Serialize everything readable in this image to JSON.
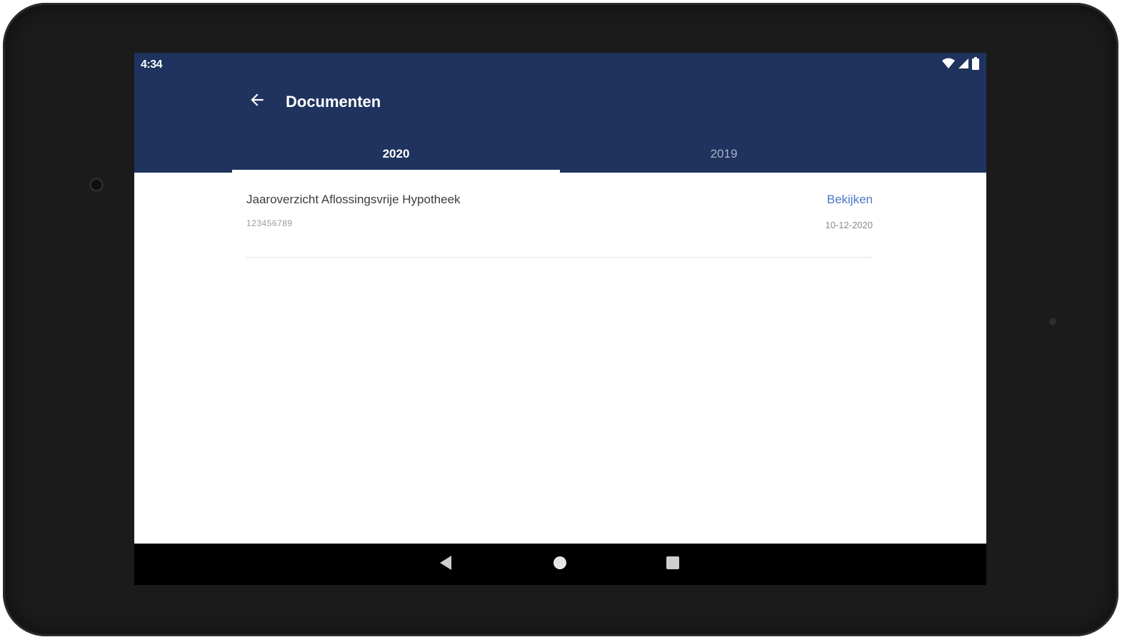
{
  "status_bar": {
    "time": "4:34",
    "icons": [
      "wifi-icon",
      "cell-signal-icon",
      "battery-icon"
    ]
  },
  "toolbar": {
    "back_icon": "arrow-back-icon",
    "title": "Documenten"
  },
  "tabs": [
    {
      "label": "2020",
      "selected": true
    },
    {
      "label": "2019",
      "selected": false
    }
  ],
  "documents": [
    {
      "title": "Jaaroverzicht Aflossingsvrije Hypotheek",
      "number": "123456789",
      "action_label": "Bekijken",
      "date": "10-12-2020"
    }
  ],
  "nav_bar": {
    "buttons": [
      "back-triangle-icon",
      "home-circle-icon",
      "recents-square-icon"
    ]
  },
  "colors": {
    "primary": "#1f335e",
    "accent": "#4a78c8",
    "device_frame": "#1b1b1b"
  }
}
